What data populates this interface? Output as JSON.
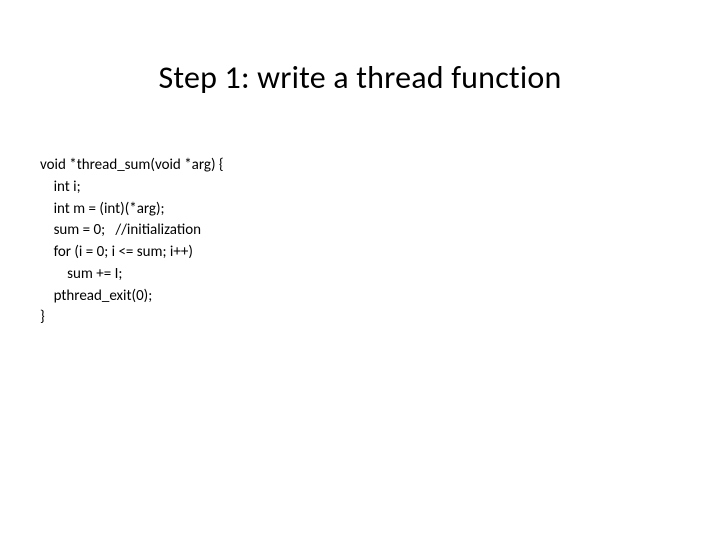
{
  "title": "Step 1: write a thread function",
  "code": {
    "l0": "void *thread_sum(void *arg) {",
    "l1": "    int i;",
    "l2": "    int m = (int)(*arg);",
    "l3": "    sum = 0;   //initialization",
    "l4": "    for (i = 0; i <= sum; i++)",
    "l5": "        sum += I;",
    "l6": "    pthread_exit(0);",
    "l7": "}"
  }
}
